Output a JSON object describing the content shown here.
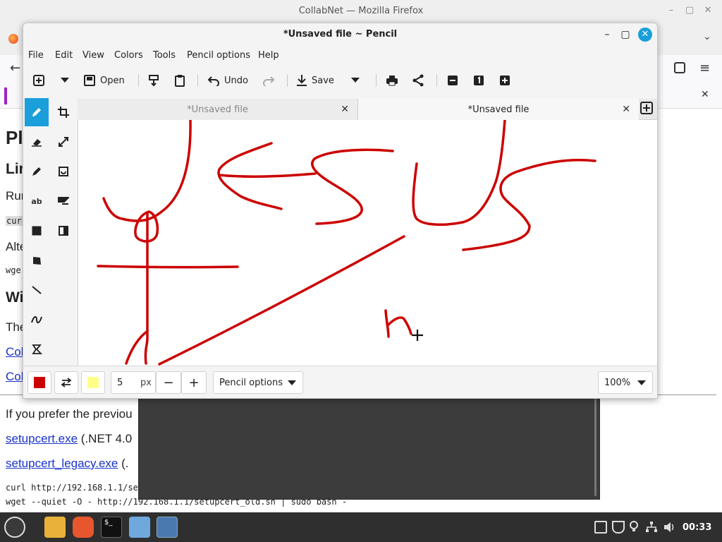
{
  "firefox": {
    "window_title": "CollabNet — Mozilla Firefox",
    "page_lines": {
      "h1_fragment": "Pl",
      "h2_fragment": "Lin",
      "run_fragment": "Run",
      "code_fragment": "cur",
      "alt_fragment": "Alte",
      "wget_fragment": "wge",
      "h2b_fragment": "Wi",
      "the_fragment": "The",
      "link1_fragment": "Col",
      "link2_fragment": "Col",
      "prefer_text": "If you prefer the previou",
      "setupcert_link": "setupcert.exe",
      "setupcert_suffix": "(.NET 4.0",
      "legacy_link": "setupcert_legacy.exe",
      "legacy_suffix": "(.",
      "curl_line": "curl http://192.168.1.1/se",
      "wget_line": "wget --quiet -O - http://192.168.1.1/setupcert_old.sh | sudo bash -"
    }
  },
  "pencil": {
    "title": "*Unsaved file ~ Pencil",
    "menu": [
      "File",
      "Edit",
      "View",
      "Colors",
      "Tools",
      "Pencil options",
      "Help"
    ],
    "toolbar": {
      "open_label": "Open",
      "undo_label": "Undo",
      "save_label": "Save"
    },
    "tabs": [
      {
        "label": "*Unsaved file",
        "active": false
      },
      {
        "label": "*Unsaved file",
        "active": true
      }
    ],
    "bottom": {
      "main_color": "#cc0000",
      "secondary_color": "#ffff88",
      "size_value": "5",
      "size_unit": "px",
      "options_label": "Pencil options",
      "zoom_label": "100%"
    },
    "stroke_color": "#cc0000"
  },
  "taskbar": {
    "time": "00:33"
  }
}
